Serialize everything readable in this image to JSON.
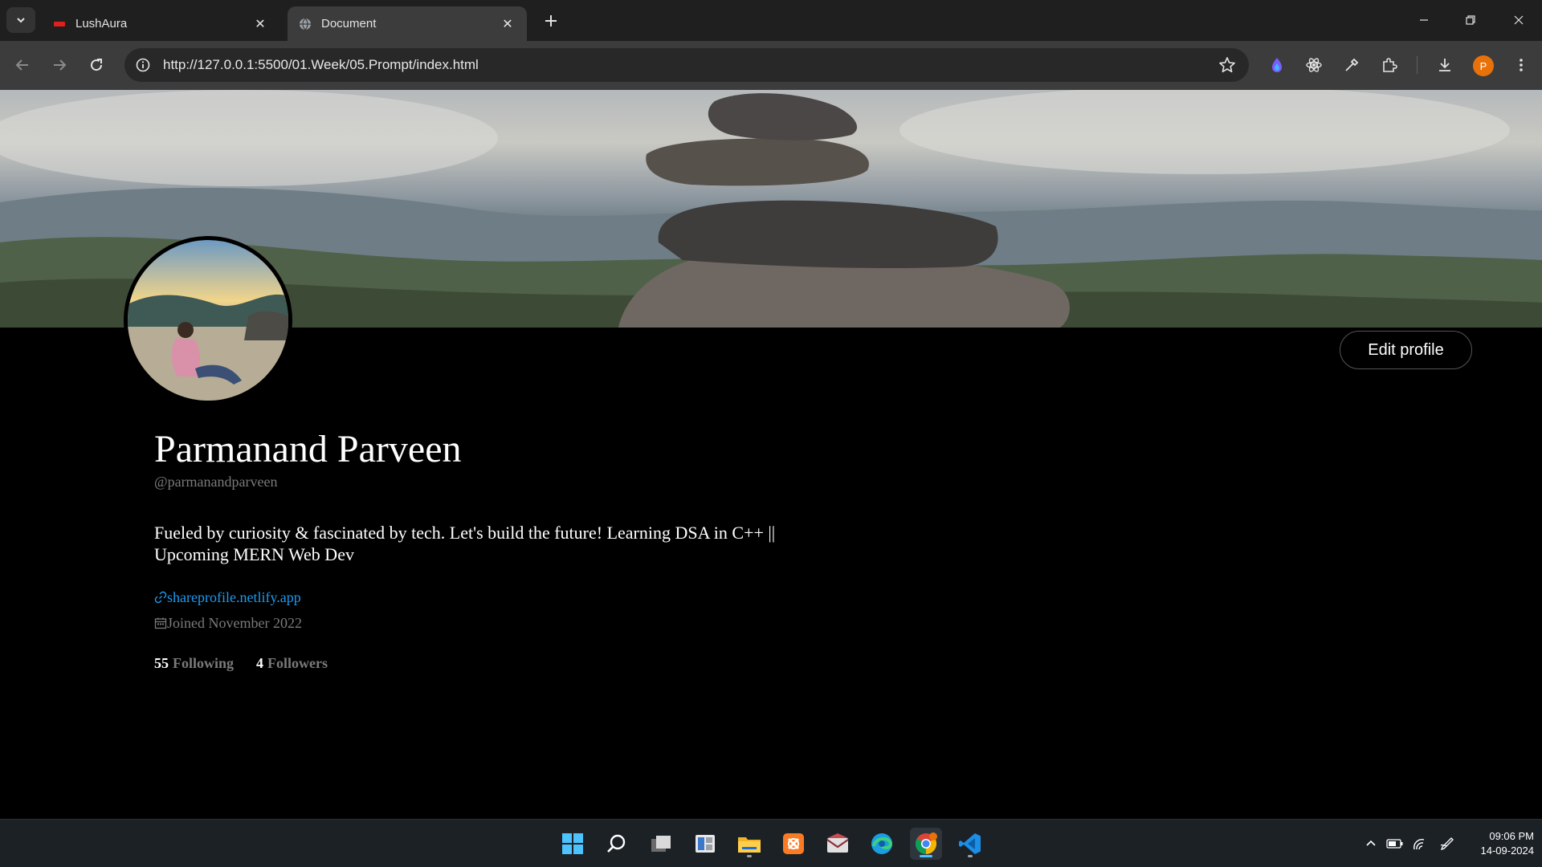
{
  "browser": {
    "tabs": [
      {
        "label": "LushAura",
        "active": false,
        "close": "✕"
      },
      {
        "label": "Document",
        "active": true,
        "close": "✕"
      }
    ],
    "url": "http://127.0.0.1:5500/01.Week/05.Prompt/index.html",
    "profile_initial": "P",
    "icons": [
      "tab-search-icon",
      "new-tab-icon",
      "minimize-icon",
      "restore-icon",
      "window-close-icon",
      "back-icon",
      "forward-icon",
      "reload-icon",
      "site-info-icon",
      "bookmark-star-icon",
      "extension-gradient-icon",
      "react-devtools-icon",
      "color-picker-icon",
      "extensions-puzzle-icon",
      "downloads-icon",
      "menu-kebab-icon"
    ]
  },
  "profile": {
    "name": "Parmanand Parveen",
    "handle": "@parmanandparveen",
    "bio": "Fueled by curiosity & fascinated by tech. Let's build the future! Learning DSA in C++ || Upcoming MERN Web Dev",
    "website": "shareprofile.netlify.app",
    "joined": "Joined November 2022",
    "edit_button": "Edit profile",
    "stats": {
      "following_count": "55",
      "following_label": "Following",
      "followers_count": "4",
      "followers_label": "Followers"
    },
    "colors": {
      "link": "#1d9bf0",
      "muted": "#7a7a7a",
      "background": "#000000"
    }
  },
  "taskbar": {
    "apps": [
      "windows-start-icon",
      "search-icon",
      "task-view-icon",
      "widgets-icon",
      "file-explorer-icon",
      "xampp-icon",
      "mail-icon",
      "edge-icon",
      "chrome-icon",
      "vscode-icon"
    ],
    "active_app": "chrome-icon",
    "time": "09:06 PM",
    "date": "14-09-2024"
  }
}
